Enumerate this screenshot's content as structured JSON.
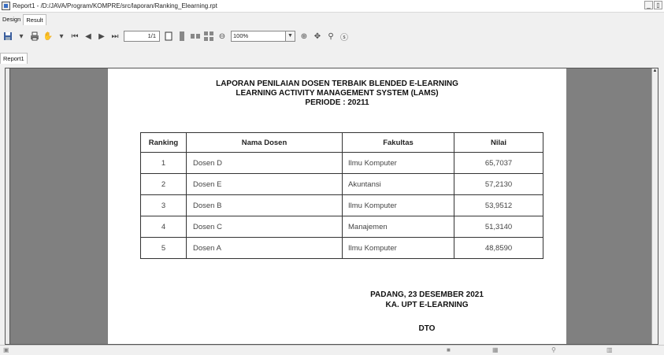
{
  "window": {
    "title": "Report1 - /D:/JAVA/Program/KOMPRE/src/laporan/Ranking_Elearning.rpt",
    "minimize_label": "_",
    "restore_label": "▯"
  },
  "top_tabs": [
    {
      "label": "Design"
    },
    {
      "label": "Result"
    }
  ],
  "toolbar": {
    "page_value": "1/1",
    "zoom_value": "100%",
    "icons": [
      "export-icon",
      "print-icon",
      "hand-icon",
      "first-page-icon",
      "prev-page-icon",
      "next-page-icon",
      "last-page-icon",
      "single-page-icon",
      "multi-page-icon",
      "zoom-icon",
      "search-icon",
      "help-icon"
    ]
  },
  "report_tabs": [
    {
      "label": "Report1"
    }
  ],
  "report": {
    "title_line1": "LAPORAN PENILAIAN DOSEN TERBAIK BLENDED E-LEARNING",
    "title_line2": "LEARNING ACTIVITY MANAGEMENT SYSTEM (LAMS)",
    "title_line3": "PERIODE : 20211",
    "headers": [
      "Ranking",
      "Nama Dosen",
      "Fakultas",
      "Nilai"
    ],
    "rows": [
      [
        "1",
        "Dosen D",
        "Ilmu Komputer",
        "65,7037"
      ],
      [
        "2",
        "Dosen E",
        "Akuntansi",
        "57,2130"
      ],
      [
        "3",
        "Dosen B",
        "Ilmu Komputer",
        "53,9512"
      ],
      [
        "4",
        "Dosen C",
        "Manajemen",
        "51,3140"
      ],
      [
        "5",
        "Dosen A",
        "Ilmu Komputer",
        "48,8590"
      ]
    ],
    "footer_line1": "PADANG, 23 DESEMBER 2021",
    "footer_line2": "KA. UPT E-LEARNING",
    "footer_line3": "DTO"
  }
}
